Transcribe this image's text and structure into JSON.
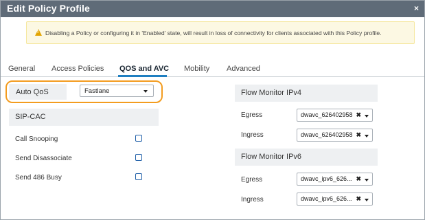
{
  "dialog": {
    "title": "Edit Policy Profile",
    "close_glyph": "×"
  },
  "warning": {
    "icon": "warning-icon",
    "text": "Disabling a Policy or configuring it in 'Enabled' state, will result in loss of connectivity for clients associated with this Policy profile."
  },
  "tabs": [
    {
      "label": "General",
      "active": false
    },
    {
      "label": "Access Policies",
      "active": false
    },
    {
      "label": "QOS and AVC",
      "active": true
    },
    {
      "label": "Mobility",
      "active": false
    },
    {
      "label": "Advanced",
      "active": false
    }
  ],
  "auto_qos": {
    "label": "Auto QoS",
    "value": "Fastlane",
    "highlight_color": "#f39c1f"
  },
  "sip_cac": {
    "heading": "SIP-CAC",
    "rows": [
      {
        "label": "Call Snooping",
        "checked": false
      },
      {
        "label": "Send Disassociate",
        "checked": false
      },
      {
        "label": "Send 486 Busy",
        "checked": false
      }
    ]
  },
  "flow_ipv4": {
    "heading": "Flow Monitor IPv4",
    "egress": {
      "label": "Egress",
      "value": "dwavc_626402958"
    },
    "ingress": {
      "label": "Ingress",
      "value": "dwavc_626402958"
    }
  },
  "flow_ipv6": {
    "heading": "Flow Monitor IPv6",
    "egress": {
      "label": "Egress",
      "value": "dwavc_ipv6_626..."
    },
    "ingress": {
      "label": "Ingress",
      "value": "dwavc_ipv6_626..."
    }
  },
  "colors": {
    "titlebar": "#5f6b78",
    "accent": "#1f7fc1",
    "checkbox": "#1f5fa8",
    "warning_bg": "#fcf8e3"
  }
}
